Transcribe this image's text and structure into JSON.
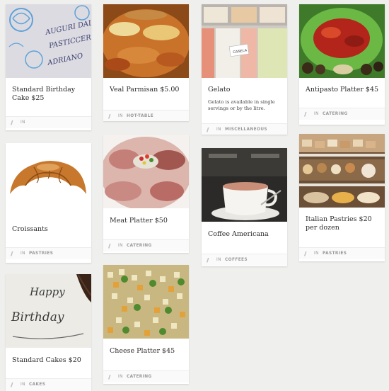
{
  "labels": {
    "in": "IN"
  },
  "items": [
    {
      "title": "Standard Birthday Cake $25",
      "category": ""
    },
    {
      "title": "Veal Parmisan $5.00",
      "category": "HOT-TABLE"
    },
    {
      "title": "Gelato",
      "description": "Gelato is available in single servings or by the litre.",
      "category": "MISCELLANEOUS"
    },
    {
      "title": "Antipasto Platter $45",
      "category": "CATERING"
    },
    {
      "title": "Croissants",
      "category": "PASTRIES"
    },
    {
      "title": "Meat Platter $50",
      "category": "CATERING"
    },
    {
      "title": "Coffee Americana",
      "category": "COFFEES"
    },
    {
      "title": "Italian Pastries $20 per dozen",
      "category": "PASTRIES"
    },
    {
      "title": "Standard Cakes $20",
      "category": "CAKES"
    },
    {
      "title": "Cheese Platter $45",
      "category": "CATERING"
    }
  ],
  "photos": {
    "birthday_cake_text": [
      "AUGURI DAL",
      "PASTICCERE",
      "ADRIANO"
    ],
    "gelato_tag": "CANELA",
    "standard_cake_text": [
      "Happy",
      "Birthday"
    ]
  }
}
